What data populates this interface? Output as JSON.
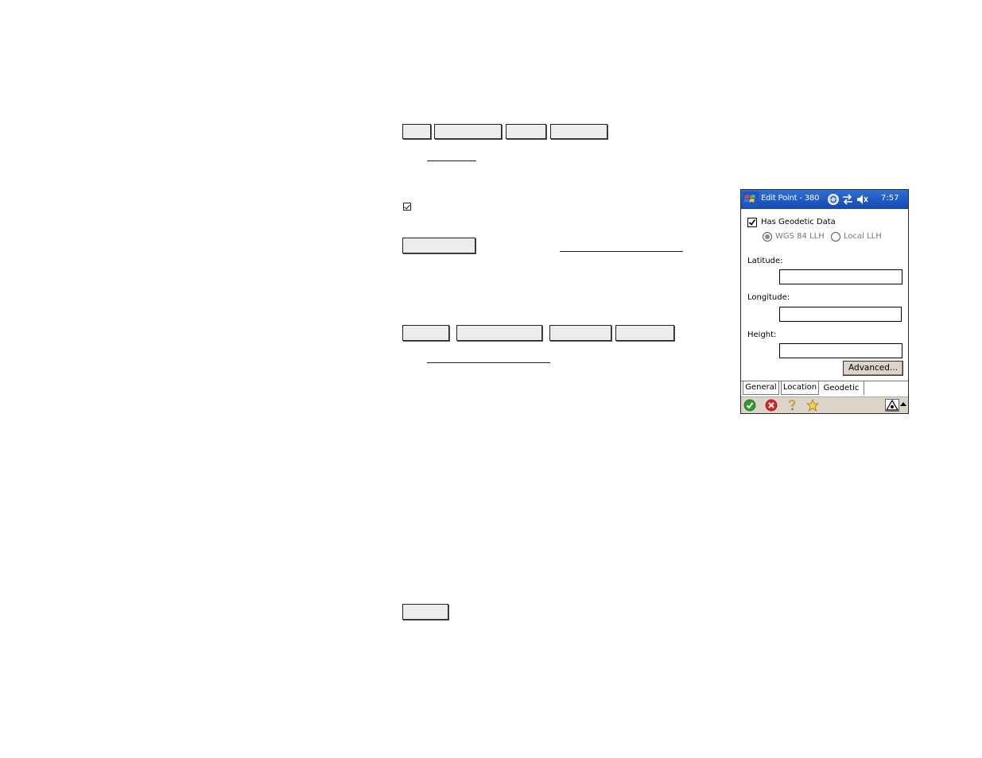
{
  "window": {
    "title": "Edit Point - 380",
    "clock": "7:57"
  },
  "geodetic": {
    "has_geodetic_label": "Has Geodetic Data",
    "has_geodetic_checked": true,
    "radio_wgs": "WGS 84 LLH",
    "radio_local": "Local LLH",
    "selected": "WGS 84 LLH"
  },
  "fields": {
    "latitude_label": "Latitude:",
    "latitude_value": "",
    "longitude_label": "Longitude:",
    "longitude_value": "",
    "height_label": "Height:",
    "height_value": ""
  },
  "buttons": {
    "advanced": "Advanced..."
  },
  "tabs": [
    {
      "label": "General",
      "active": false
    },
    {
      "label": "Location",
      "active": false
    },
    {
      "label": "Geodetic",
      "active": true
    }
  ],
  "icons": {
    "start": "windows-flag-icon",
    "sync": "sync-icon",
    "connectivity": "connectivity-arrows-icon",
    "volume": "speaker-muted-icon",
    "ok": "green-check-icon",
    "cancel": "red-x-icon",
    "help": "question-mark-icon",
    "favorite": "star-icon",
    "input_panel": "input-panel-icon",
    "up_arrow": "up-arrow-icon"
  }
}
